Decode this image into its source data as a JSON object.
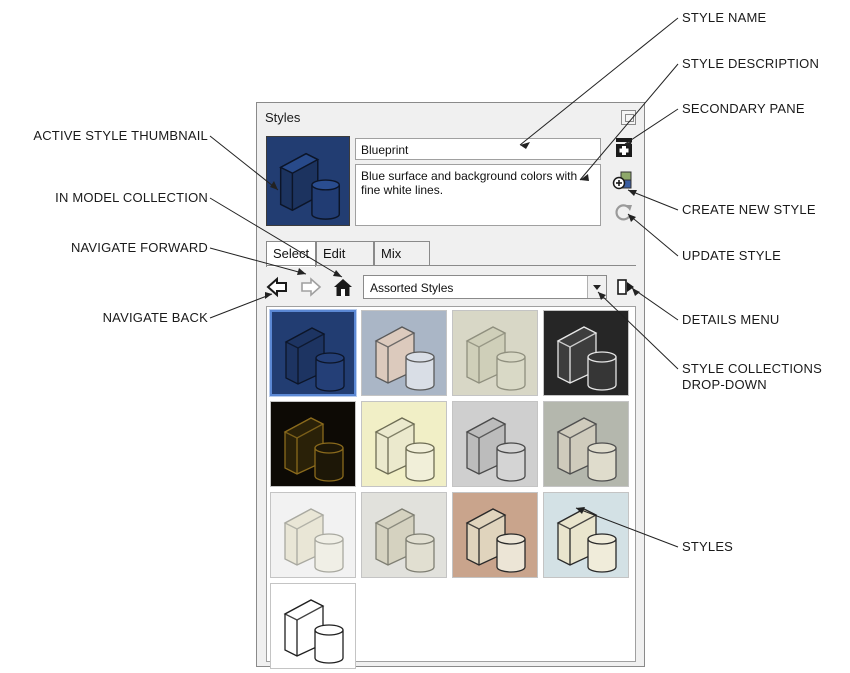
{
  "panel": {
    "title": "Styles",
    "style_name": "Blueprint",
    "style_description": "Blue surface and background colors with fine white lines.",
    "tabs": [
      {
        "label": "Select",
        "active": true
      },
      {
        "label": "Edit",
        "active": false
      },
      {
        "label": "Mix",
        "active": false
      }
    ],
    "collection_dropdown": {
      "selected": "Assorted Styles"
    },
    "thumbnails": [
      {
        "bg": "#223d72",
        "box": "#1d3462",
        "cyl": "#243f77",
        "line": "#0c1528",
        "selected": true
      },
      {
        "bg": "#aab6c6",
        "box": "#dccabd",
        "cyl": "#d9dee6",
        "line": "#5a5a5a",
        "selected": false
      },
      {
        "bg": "#d8d7c6",
        "box": "#cfcfb9",
        "cyl": "#d9d9c6",
        "line": "#8f8f7e",
        "selected": false
      },
      {
        "bg": "#262626",
        "box": "#3d3d3d",
        "cyl": "#363636",
        "line": "#e6e6e6",
        "selected": false
      },
      {
        "bg": "#0d0a05",
        "box": "#2a2108",
        "cyl": "#1d1707",
        "line": "#8a6a1c",
        "selected": false
      },
      {
        "bg": "#f1efc6",
        "box": "#ebe9cd",
        "cyl": "#f1efd9",
        "line": "#6e6d55",
        "selected": false
      },
      {
        "bg": "#cfcfcf",
        "box": "#bcbcbc",
        "cyl": "#d4d4d4",
        "line": "#4a4a4a",
        "selected": false
      },
      {
        "bg": "#b4b7ad",
        "box": "#cfcbbc",
        "cyl": "#dfdccc",
        "line": "#4f4f4f",
        "selected": false
      },
      {
        "bg": "#f2f2f2",
        "box": "#e9e6d6",
        "cyl": "#f0efe6",
        "line": "#a9a9a0",
        "selected": false
      },
      {
        "bg": "#e1e1dc",
        "box": "#d5d2c0",
        "cyl": "#e1dfd1",
        "line": "#7f7f73",
        "selected": false
      },
      {
        "bg": "#c9a48c",
        "box": "#e0d4bd",
        "cyl": "#ece5d6",
        "line": "#2a2a2a",
        "selected": false
      },
      {
        "bg": "#d3e1e5",
        "box": "#e9e5cd",
        "cyl": "#f0ecda",
        "line": "#2a2a2a",
        "selected": false
      },
      {
        "bg": "#ffffff",
        "box": "#ffffff",
        "cyl": "#ffffff",
        "line": "#202020",
        "selected": false
      }
    ]
  },
  "callouts": {
    "style_name": "STYLE NAME",
    "style_description": "STYLE DESCRIPTION",
    "secondary_pane": "SECONDARY PANE",
    "create_new_style": "CREATE NEW STYLE",
    "update_style": "UPDATE STYLE",
    "details_menu": "DETAILS MENU",
    "style_collections_line1": "STYLE COLLECTIONS",
    "style_collections_line2": "DROP-DOWN",
    "styles": "STYLES",
    "active_style_thumbnail": "ACTIVE STYLE THUMBNAIL",
    "in_model_collection": "IN MODEL COLLECTION",
    "navigate_forward": "NAVIGATE FORWARD",
    "navigate_back": "NAVIGATE BACK"
  },
  "icons": {
    "close": "close-icon",
    "secondary_pane": "secondary-pane-icon",
    "create_new_style": "create-style-icon",
    "update_style": "update-style-icon",
    "navigate_back": "arrow-left-icon",
    "navigate_forward": "arrow-right-icon",
    "in_model": "house-icon",
    "details_menu": "details-menu-icon"
  }
}
